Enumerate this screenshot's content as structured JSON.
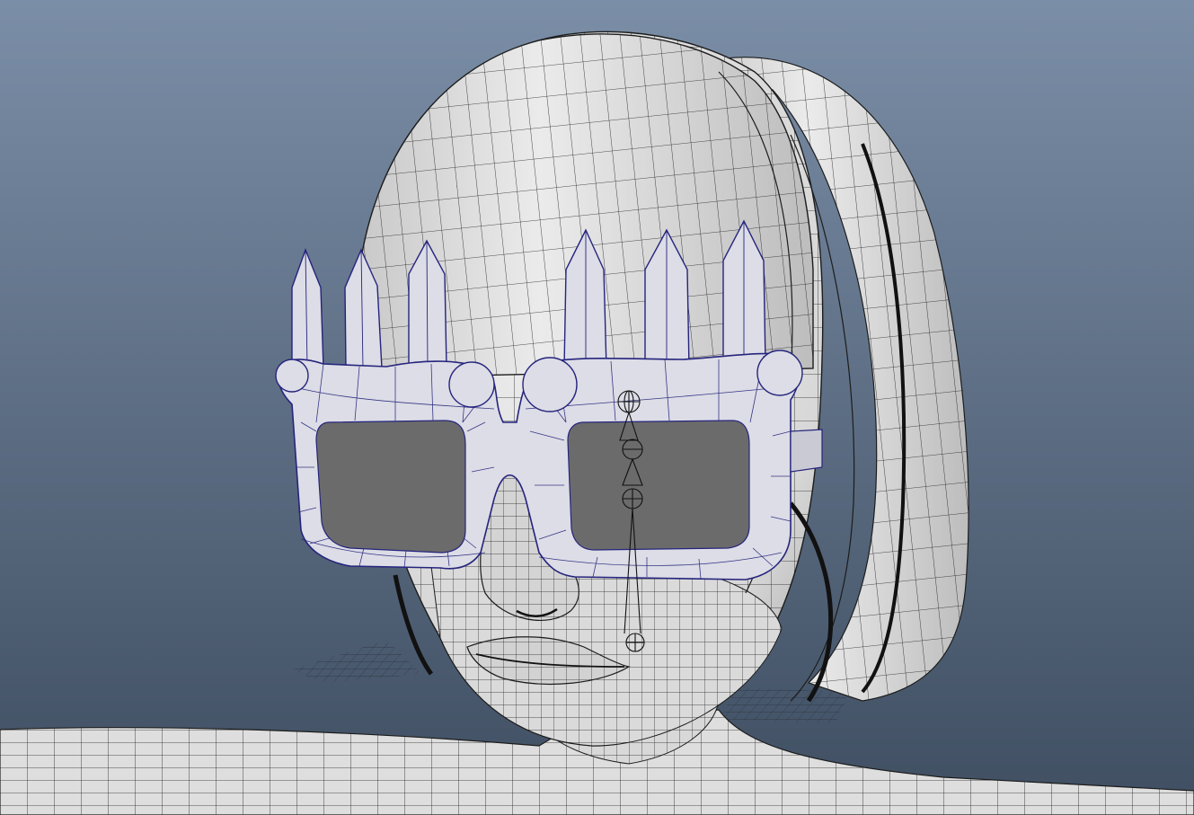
{
  "viewport": {
    "background_top": "#7b8ea7",
    "background_bottom": "#3f4e61"
  },
  "model": {
    "skin_fill": "#dcdcdc",
    "hair_fill": "#e2e2e2",
    "wire_color": "#1c1c1c",
    "selected_wire_color": "#26247d",
    "lens_fill": "#6b6b6b",
    "ground_grid_color": "#26303d"
  }
}
